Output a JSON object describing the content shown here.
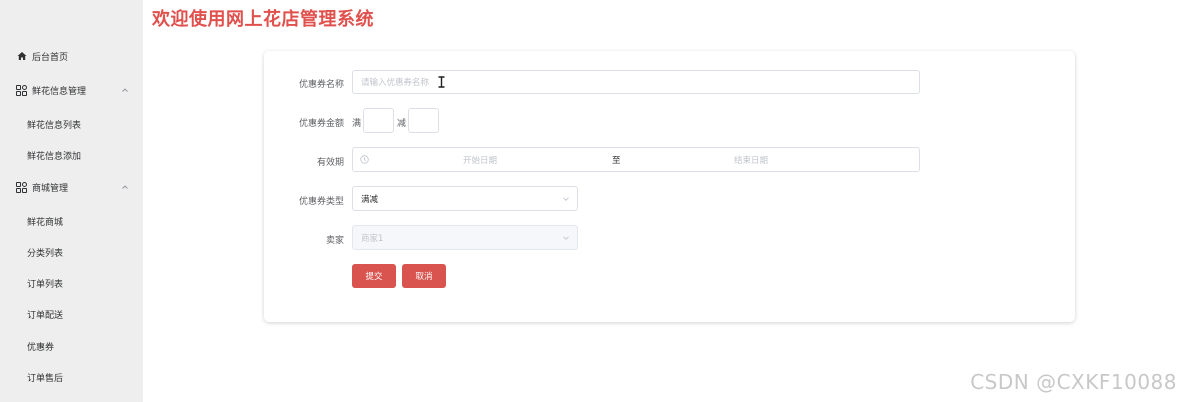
{
  "header": {
    "title": "欢迎使用网上花店管理系统"
  },
  "sidebar": {
    "items": [
      {
        "label": "后台首页",
        "icon": "home-icon"
      },
      {
        "label": "鲜花信息管理",
        "icon": "grid-icon",
        "expanded": true
      },
      {
        "label": "鲜花信息列表"
      },
      {
        "label": "鲜花信息添加"
      },
      {
        "label": "商城管理",
        "icon": "grid-icon",
        "expanded": true
      },
      {
        "label": "鲜花商城"
      },
      {
        "label": "分类列表"
      },
      {
        "label": "订单列表"
      },
      {
        "label": "订单配送"
      },
      {
        "label": "优惠券"
      },
      {
        "label": "订单售后"
      }
    ]
  },
  "form": {
    "name_label": "优惠券名称",
    "name_placeholder": "请输入优惠券名称",
    "amount_label": "优惠券金额",
    "amount_full": "满",
    "amount_minus": "减",
    "period_label": "有效期",
    "start_placeholder": "开始日期",
    "range_sep": "至",
    "end_placeholder": "结束日期",
    "type_label": "优惠券类型",
    "type_value": "满减",
    "seller_label": "卖家",
    "seller_placeholder": "商家1",
    "submit_label": "提交",
    "cancel_label": "取消"
  },
  "watermark": "CSDN @CXKF10088",
  "colors": {
    "accent": "#d9534f",
    "title": "#e0514d",
    "sidebar_bg": "#eeeeee"
  }
}
